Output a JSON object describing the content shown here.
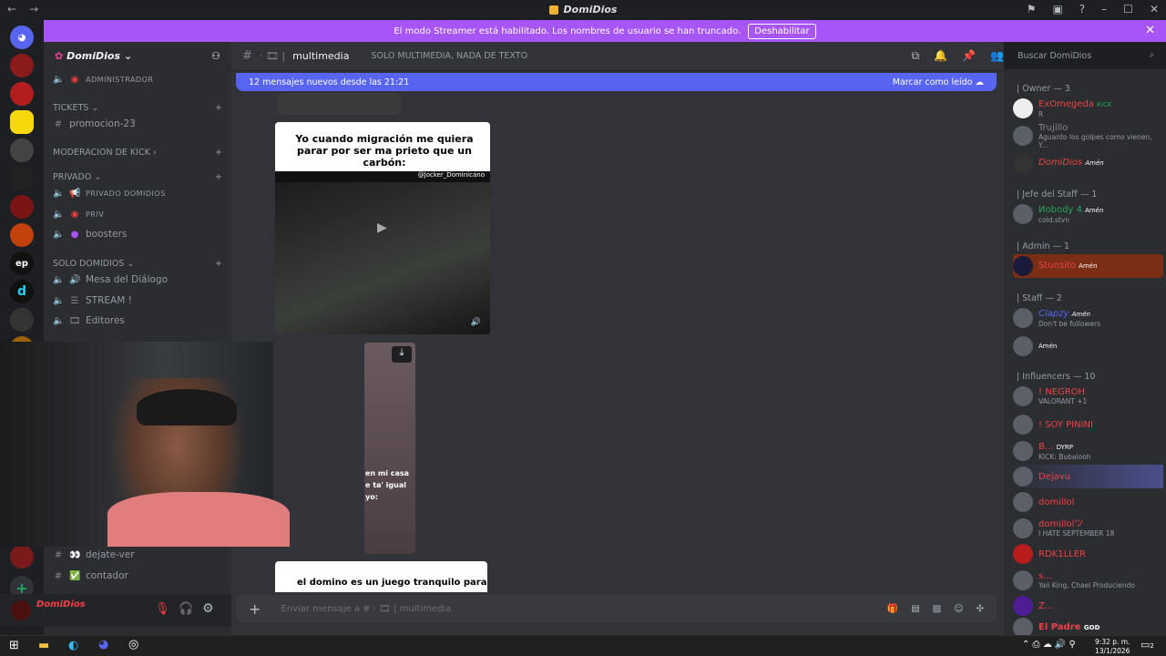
{
  "window": {
    "title": "DomiDios"
  },
  "banner": {
    "text": "El modo Streamer está habilitado. Los nombres de usuario se han truncado.",
    "button": "Deshabilitar"
  },
  "server": {
    "name": "DomiDios"
  },
  "channels": {
    "admin_label": "ADMINISTRADOR",
    "cat_tickets": "TICKETS",
    "promo": "promocion-23",
    "cat_mod": "MODERACION DE KICK",
    "cat_priv": "PRIVADO",
    "priv_domidios": "PRIVADO DOMIDIOS",
    "priv": "PRIV",
    "boosters": "boosters",
    "cat_solo": "SOLO DOMIDIOS",
    "mesa": "Mesa del Diálogo",
    "stream": "STREAM !",
    "editores": "Editores",
    "dejate": "dejate-ver",
    "contador": "contador"
  },
  "user": {
    "name": "DomiDios"
  },
  "chat": {
    "channel_name": "multimedia",
    "topic": "SOLO MULTIMEDIA, NADA DE TEXTO",
    "new_messages": "12 mensajes nuevos desde las 21:21",
    "mark_read": "Marcar como leído",
    "meme1_caption": "Yo cuando migración me quiera parar por ser ma prieto que un carbón:",
    "meme1_handle": "@Jocker_Dominicano",
    "meme2_caption_a": "en mi casa",
    "meme2_caption_b": "e ta' igual",
    "meme2_caption_c": "yo:",
    "meme3_caption": "el domino es un juego tranquilo para",
    "composer_placeholder": "Enviar mensaje a #",
    "composer_channel": "multimedia"
  },
  "search": {
    "placeholder": "Buscar DomiDios"
  },
  "members": {
    "owner": "| Owner — 3",
    "m1": "ExOmegeda",
    "m1_badge": "KICK",
    "m1_status": "R",
    "m2": "Trujillo",
    "m2_status": "Aguanto los golpes como vienen, Y...",
    "m3": "DomiDios",
    "m3_badge": "Amén",
    "jefe": "| Jefe del Staff — 1",
    "m4": "Иobody 4",
    "m4_badge": "Amén",
    "m4_status": "cold.stvn",
    "admin": "| Admin — 1",
    "m5": "Stunsito",
    "m5_badge": "Amén",
    "staff": "| Staff — 2",
    "m6": "Clapzy",
    "m6_badge": "Amén",
    "m6_status": "Don't be followers",
    "m7_badge": "Amén",
    "influencers": "| Influencers — 10",
    "m8": "! NEGROH",
    "m8_status": "VALORANT +1",
    "m9": "! SOY PININI",
    "m10": "B...",
    "m10_badge": "DYRP",
    "m10_status": "KICK: Bubalooh",
    "m11": "Dejavu",
    "m12": "domiilol",
    "m13": "domiilolツ",
    "m13_status": "I HATE SEPTEMBER 18",
    "m14": "RDK1LLER",
    "m15": "s...",
    "m15_status": "Yaii King, Chael Produciendo",
    "m16": "Z...",
    "m17": "El Padre",
    "m17_badge": "GOD"
  },
  "taskbar": {
    "time": "9:32 p. m.",
    "date": "13/1/2026",
    "notif": "2"
  },
  "colors": {
    "accent": "#5865f2",
    "banner": "#a855f7",
    "online": "#23a55a",
    "dnd": "#f23f43"
  }
}
